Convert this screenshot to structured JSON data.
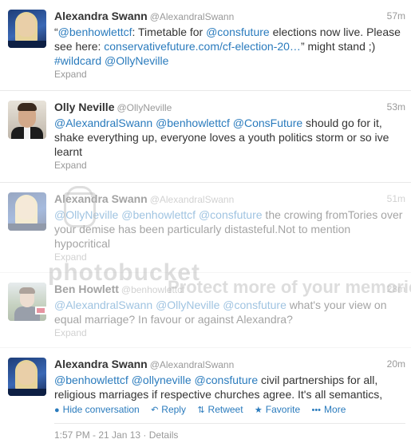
{
  "tweets": [
    {
      "name": "Alexandra Swann",
      "handle": "@AlexandralSwann",
      "time": "57m",
      "text_parts": [
        "“",
        "@benhowlettcf",
        ": Timetable for ",
        "@consfuture",
        " elections now live. Please see here: ",
        "conservativefuture.com/cf-election-20…",
        "” might stand ;)",
        "#wildcard",
        " ",
        "@OllyNeville"
      ],
      "expand": "Expand"
    },
    {
      "name": "Olly Neville",
      "handle": "@OllyNeville",
      "time": "53m",
      "text_parts": [
        "@AlexandralSwann",
        " ",
        "@benhowlettcf",
        " ",
        "@ConsFuture",
        " should go for it, shake everything up, everyone loves a youth politics storm or so ive learnt"
      ],
      "expand": "Expand"
    },
    {
      "name": "Alexandra Swann",
      "handle": "@AlexandralSwann",
      "time": "51m",
      "text_parts": [
        "@OllyNeville",
        " ",
        "@benhowlettcf",
        " ",
        "@consfuture",
        " the crowing fromTories over your demise has been particularly distasteful.Not to mention hypocritical"
      ],
      "expand": "Expand"
    },
    {
      "name": "Ben Howlett",
      "handle": "@benhowlettcf",
      "time": "28m",
      "text_parts": [
        "@AlexandralSwann",
        " ",
        "@OllyNeville",
        " ",
        "@consfuture",
        " what's your view on equal marriage? In favour or against Alexandra?"
      ],
      "expand": "Expand"
    },
    {
      "name": "Alexandra Swann",
      "handle": "@AlexandralSwann",
      "time": "20m",
      "text_parts": [
        "@benhowlettcf",
        " ",
        "@ollyneville",
        " ",
        "@consfuture",
        " civil partnerships for all, religious marriages if respective churches agree. It's all semantics,"
      ],
      "actions": {
        "hide": "Hide conversation",
        "reply": "Reply",
        "retweet": "Retweet",
        "favorite": "Favorite",
        "more": "More"
      },
      "meta": "1:57 PM - 21 Jan 13 · Details"
    }
  ],
  "watermark": {
    "logo": "photobucket",
    "tagline": "Protect more of your memories for less!"
  },
  "colors": {
    "link": "#2a7bbd",
    "muted": "#999999",
    "text": "#333333"
  }
}
